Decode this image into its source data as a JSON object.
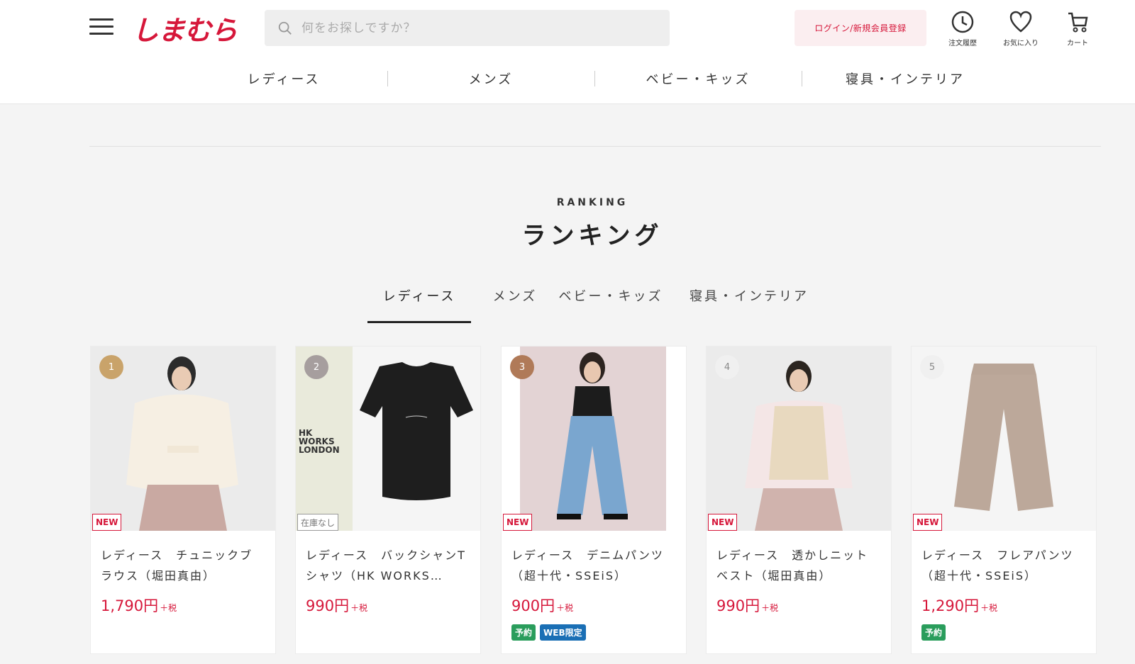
{
  "header": {
    "logo": "しまむら",
    "search_placeholder": "何をお探しですか？",
    "login_label": "ログイン/新規会員登録",
    "icons": [
      {
        "name": "history-icon",
        "label": "注文履歴"
      },
      {
        "name": "heart-icon",
        "label": "お気に入り"
      },
      {
        "name": "cart-icon",
        "label": "カート"
      }
    ],
    "nav": [
      "レディース",
      "メンズ",
      "ベビー・キッズ",
      "寝具・インテリア"
    ]
  },
  "ranking": {
    "eyebrow": "RANKING",
    "title": "ランキング",
    "tabs": [
      "レディース",
      "メンズ",
      "ベビー・キッズ",
      "寝具・インテリア"
    ],
    "active_tab": "レディース"
  },
  "products": [
    {
      "rank": "1",
      "rank_color": "#c9a36a",
      "tag": "NEW",
      "name": "レディース　チュニックブラウス（堀田真由）",
      "price": "1,790円",
      "tax": "＋税",
      "labels": []
    },
    {
      "rank": "2",
      "rank_color": "#a69e9e",
      "tag": "在庫なし",
      "name": "レディース　バックシャンTシャツ（HK WORKS…",
      "price": "990円",
      "tax": "＋税",
      "labels": [],
      "brand_text": "HK WORKS LONDON"
    },
    {
      "rank": "3",
      "rank_color": "#b07a58",
      "tag": "NEW",
      "name": "レディース　デニムパンツ（超十代・SSEiS）",
      "price": "900円",
      "tax": "＋税",
      "labels": [
        "予約",
        "WEB限定"
      ]
    },
    {
      "rank": "4",
      "rank_color": "#eeeeee",
      "tag": "NEW",
      "name": "レディース　透かしニットベスト（堀田真由）",
      "price": "990円",
      "tax": "＋税",
      "labels": []
    },
    {
      "rank": "5",
      "rank_color": "#eeeeee",
      "tag": "NEW",
      "name": "レディース　フレアパンツ（超十代・SSEiS）",
      "price": "1,290円",
      "tax": "＋税",
      "labels": [
        "予約"
      ]
    }
  ]
}
